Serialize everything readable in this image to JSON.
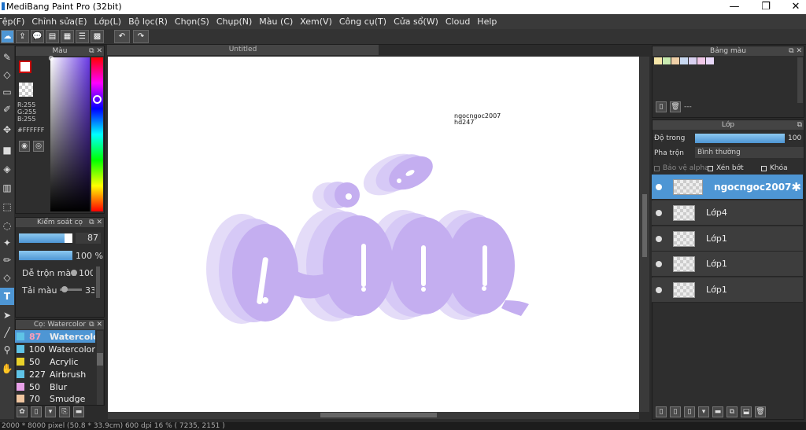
{
  "window": {
    "title": "MediBang Paint Pro (32bit)",
    "minimize": "—",
    "maximize": "❐",
    "close": "✕"
  },
  "menu": [
    "Tệp(F)",
    "Chỉnh sửa(E)",
    "Lớp(L)",
    "Bộ lọc(R)",
    "Chọn(S)",
    "Chụp(N)",
    "Màu (C)",
    "Xem(V)",
    "Công cụ(T)",
    "Cửa sổ(W)",
    "Cloud",
    "Help"
  ],
  "document": {
    "tab_title": "Untitled",
    "watermark_line1": "ngocngoc2007",
    "watermark_line2": "hd247"
  },
  "color_panel": {
    "title": "Màu",
    "r": "R:255",
    "g": "G:255",
    "b": "B:255",
    "hex": "#FFFFFF"
  },
  "brush_control": {
    "title": "Kiểm soát cọ",
    "size": "87",
    "opacity": "100 %",
    "mix_label": "Dễ trộn màu",
    "mix_value": "100",
    "load_label": "Tải màu",
    "load_value": "33"
  },
  "brush_list": {
    "title": "Cọ: Watercolor",
    "items": [
      {
        "size": "87",
        "name": "Watercolor",
        "color": "#5fc3e6",
        "selected": true
      },
      {
        "size": "100",
        "name": "Watercolor (",
        "color": "#5fc3e6",
        "selected": false
      },
      {
        "size": "50",
        "name": "Acrylic",
        "color": "#e8d12a",
        "selected": false
      },
      {
        "size": "227",
        "name": "Airbrush",
        "color": "#5fc3e6",
        "selected": false
      },
      {
        "size": "50",
        "name": "Blur",
        "color": "#e8a0e8",
        "selected": false
      },
      {
        "size": "70",
        "name": "Smudge",
        "color": "#f0c6a0",
        "selected": false
      }
    ]
  },
  "palette_panel": {
    "title": "Bảng màu",
    "swatches": [
      "#f5e6a8",
      "#c8eab0",
      "#f0d0a8",
      "#c8d8f0",
      "#d8d0f0",
      "#f0c8e8",
      "#e8d8f8"
    ],
    "placeholder": "---"
  },
  "layers_panel": {
    "title": "Lớp",
    "opacity_label": "Độ trong",
    "opacity_value": "100 %",
    "blend_label": "Pha trộn",
    "blend_value": "Bình thường",
    "protect_alpha": "Bảo vệ alpha",
    "clipping": "Xén bớt",
    "lock": "Khóa",
    "layers": [
      {
        "name": "ngocngoc2007",
        "selected": true
      },
      {
        "name": "Lớp4",
        "selected": false
      },
      {
        "name": "Lớp1",
        "selected": false
      },
      {
        "name": "Lớp1",
        "selected": false
      },
      {
        "name": "Lớp1",
        "selected": false
      }
    ]
  },
  "status": {
    "text": "2000 * 8000 pixel  (50.8 * 33.9cm)  600 dpi  16 %  ( 7235, 2151 )"
  },
  "colors": {
    "accent": "#4e96d4",
    "lettering": "#c4aef0"
  }
}
